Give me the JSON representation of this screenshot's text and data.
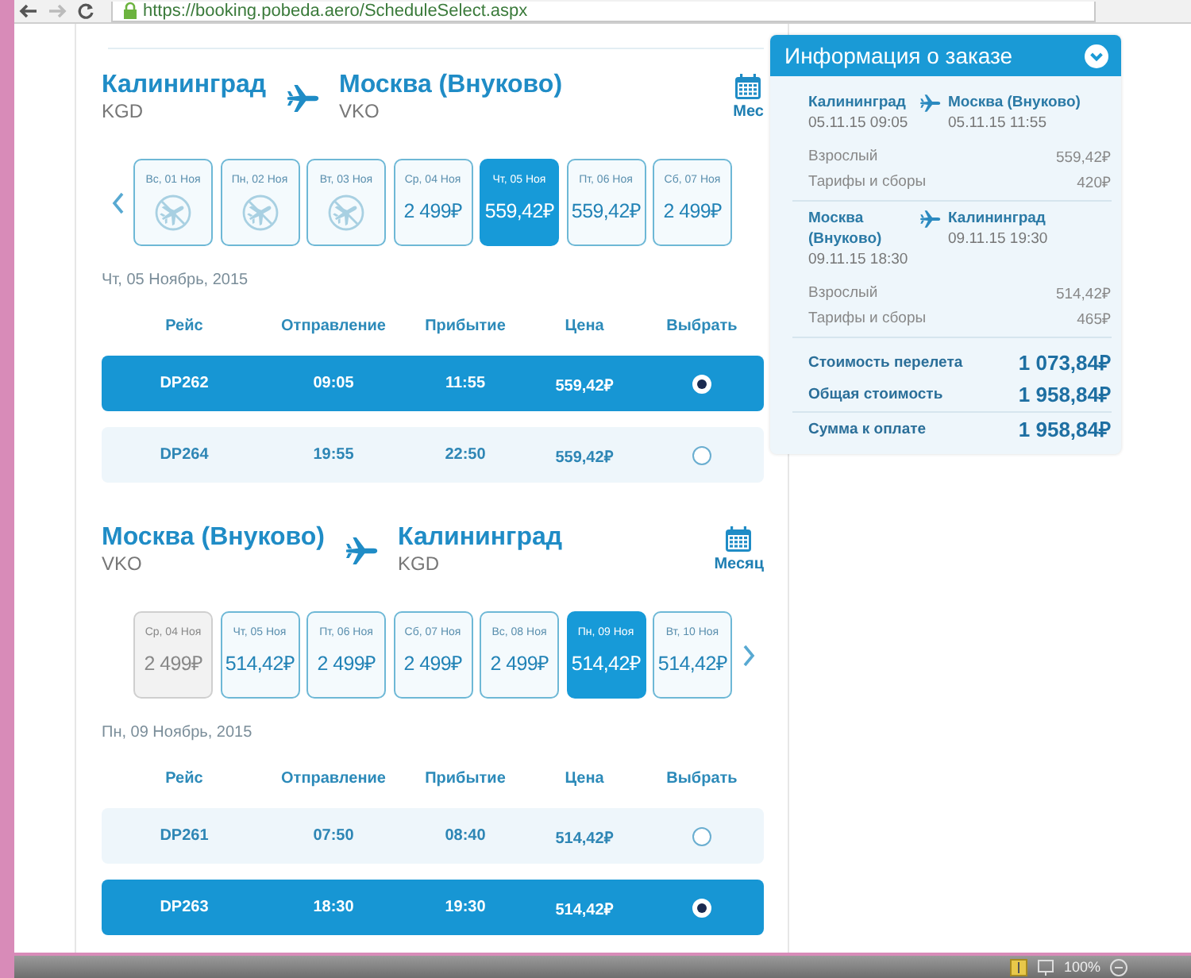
{
  "browser": {
    "url": "https://booking.pobeda.aero/ScheduleSelect.aspx"
  },
  "segments": [
    {
      "origin": {
        "city": "Калининград",
        "code": "KGD"
      },
      "destination": {
        "city": "Москва (Внуково)",
        "code": "VKO"
      },
      "calendar_label": "Мес",
      "prev_arrow": true,
      "next_arrow": false,
      "days": [
        {
          "label": "Вс, 01 Ноя",
          "kind": "no_flights",
          "selected": false,
          "disabled": false
        },
        {
          "label": "Пн, 02 Ноя",
          "kind": "no_flights",
          "selected": false,
          "disabled": false
        },
        {
          "label": "Вт, 03 Ноя",
          "kind": "no_flights",
          "selected": false,
          "disabled": false
        },
        {
          "label": "Ср, 04 Ноя",
          "kind": "price",
          "price": "2 499₽",
          "selected": false,
          "disabled": false
        },
        {
          "label": "Чт, 05 Ноя",
          "kind": "price",
          "price": "559,42₽",
          "selected": true,
          "disabled": false
        },
        {
          "label": "Пт, 06 Ноя",
          "kind": "price",
          "price": "559,42₽",
          "selected": false,
          "disabled": false
        },
        {
          "label": "Сб, 07 Ноя",
          "kind": "price",
          "price": "2 499₽",
          "selected": false,
          "disabled": false
        }
      ],
      "date_label": "Чт, 05 Ноябрь, 2015",
      "columns": [
        "Рейс",
        "Отправление",
        "Прибытие",
        "Цена",
        "Выбрать"
      ],
      "flights": [
        {
          "number": "DP262",
          "departure": "09:05",
          "arrival": "11:55",
          "price": "559,42₽",
          "selected": true
        },
        {
          "number": "DP264",
          "departure": "19:55",
          "arrival": "22:50",
          "price": "559,42₽",
          "selected": false
        }
      ]
    },
    {
      "origin": {
        "city": "Москва (Внуково)",
        "code": "VKO"
      },
      "destination": {
        "city": "Калининград",
        "code": "KGD"
      },
      "calendar_label": "Месяц",
      "prev_arrow": false,
      "next_arrow": true,
      "days": [
        {
          "label": "Ср, 04 Ноя",
          "kind": "price",
          "price": "2 499₽",
          "selected": false,
          "disabled": true
        },
        {
          "label": "Чт, 05 Ноя",
          "kind": "price",
          "price": "514,42₽",
          "selected": false,
          "disabled": false
        },
        {
          "label": "Пт, 06 Ноя",
          "kind": "price",
          "price": "2 499₽",
          "selected": false,
          "disabled": false
        },
        {
          "label": "Сб, 07 Ноя",
          "kind": "price",
          "price": "2 499₽",
          "selected": false,
          "disabled": false
        },
        {
          "label": "Вс, 08 Ноя",
          "kind": "price",
          "price": "2 499₽",
          "selected": false,
          "disabled": false
        },
        {
          "label": "Пн, 09 Ноя",
          "kind": "price",
          "price": "514,42₽",
          "selected": true,
          "disabled": false
        },
        {
          "label": "Вт, 10 Ноя",
          "kind": "price",
          "price": "514,42₽",
          "selected": false,
          "disabled": false
        }
      ],
      "date_label": "Пн, 09 Ноябрь, 2015",
      "columns": [
        "Рейс",
        "Отправление",
        "Прибытие",
        "Цена",
        "Выбрать"
      ],
      "flights": [
        {
          "number": "DP261",
          "departure": "07:50",
          "arrival": "08:40",
          "price": "514,42₽",
          "selected": false
        },
        {
          "number": "DP263",
          "departure": "18:30",
          "arrival": "19:30",
          "price": "514,42₽",
          "selected": true
        }
      ]
    }
  ],
  "order": {
    "title": "Информация о заказе",
    "legs": [
      {
        "from": "Калининград",
        "from_time": "05.11.15 09:05",
        "to": "Москва (Внуково)",
        "to_time": "05.11.15 11:55",
        "lines": [
          {
            "label": "Взрослый",
            "value": "559,42₽"
          },
          {
            "label": "Тарифы и сборы",
            "value": "420₽"
          }
        ]
      },
      {
        "from": "Москва (Внуково)",
        "from_time": "09.11.15 18:30",
        "to": "Калининград",
        "to_time": "09.11.15 19:30",
        "lines": [
          {
            "label": "Взрослый",
            "value": "514,42₽"
          },
          {
            "label": "Тарифы и сборы",
            "value": "465₽"
          }
        ]
      }
    ],
    "totals": [
      {
        "label": "Стоимость перелета",
        "value": "1 073,84₽"
      },
      {
        "label": "Общая стоимость",
        "value": "1 958,84₽"
      },
      {
        "label": "Сумма к оплате",
        "value": "1 958,84₽"
      }
    ]
  },
  "status_bar": {
    "zoom": "100%"
  }
}
